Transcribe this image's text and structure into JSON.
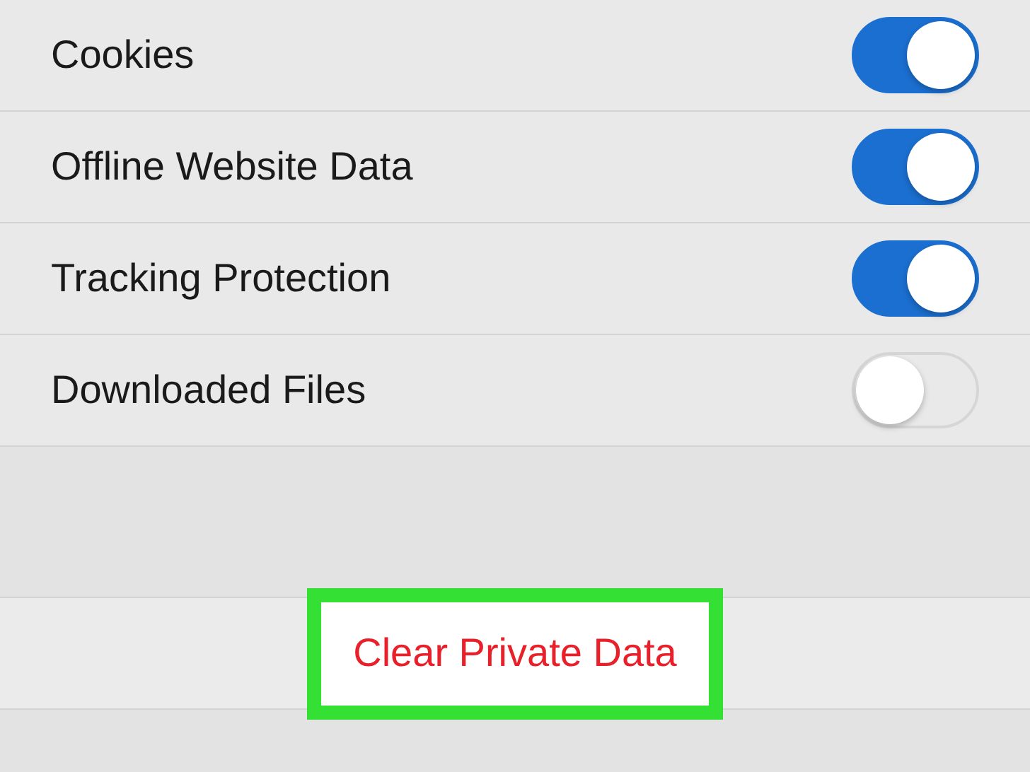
{
  "settings": [
    {
      "label": "Cookies",
      "on": true
    },
    {
      "label": "Offline Website Data",
      "on": true
    },
    {
      "label": "Tracking Protection",
      "on": true
    },
    {
      "label": "Downloaded Files",
      "on": false
    }
  ],
  "action_button": {
    "label": "Clear Private Data",
    "highlighted": true
  }
}
